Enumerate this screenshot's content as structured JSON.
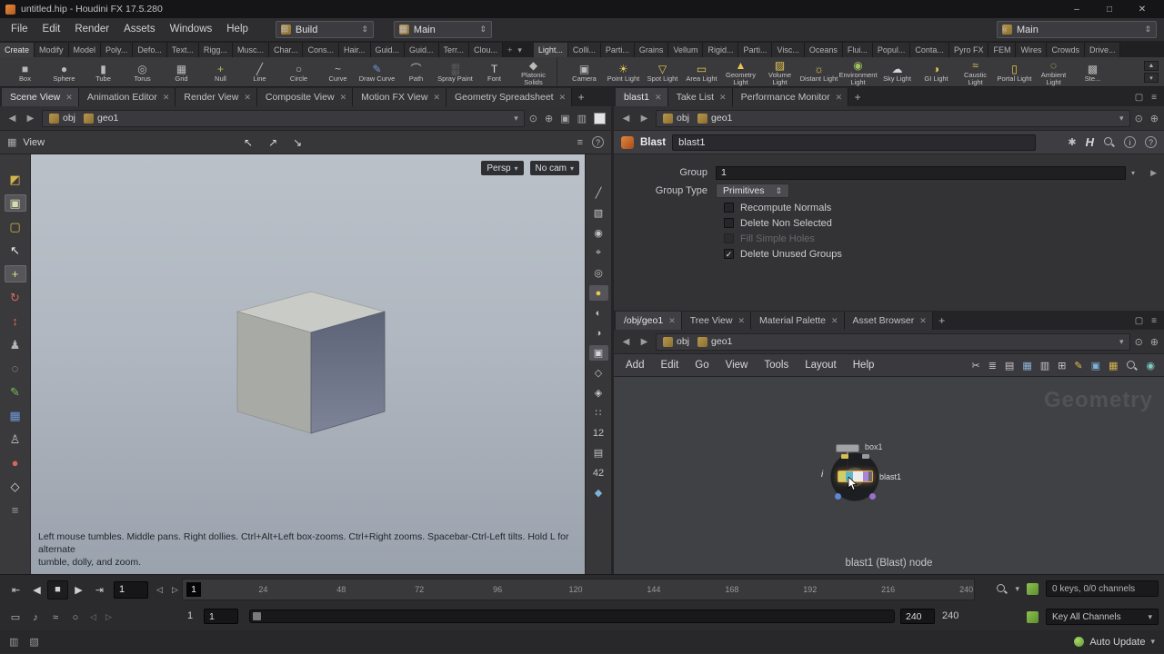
{
  "window": {
    "title": "untitled.hip - Houdini FX 17.5.280",
    "controls": {
      "minimize": "–",
      "maximize": "□",
      "close": "✕"
    }
  },
  "menubar": {
    "menus": [
      "File",
      "Edit",
      "Render",
      "Assets",
      "Windows",
      "Help"
    ],
    "desktop_combo": "Build",
    "scene_combo": "Main",
    "right_combo": "Main"
  },
  "icons": {
    "back": "◀",
    "forward": "▶",
    "down": "▾",
    "updown": "⇕",
    "add": "+",
    "close_tab": "✕",
    "pin": "⊙",
    "target": "⊕",
    "pane_max": "▢",
    "pane_menu": "≡",
    "grid": "▦",
    "presets": "✱",
    "hlogo": "H",
    "info": "i",
    "help": "?",
    "cursor1": "↖",
    "cursor2": "↗",
    "cursor3": "↘",
    "desktop_ico": "⊞",
    "scene_ico": "▦",
    "right_ico": "«",
    "cam1": "▣",
    "cam2": "▥",
    "eye": "◉",
    "tostart": "⇤",
    "prevframe": "◀",
    "stop": "■",
    "play": "▶",
    "toend": "⇥",
    "prevkey": "◁",
    "nextkey": "▷",
    "flipbook": "▭",
    "audio": "♪",
    "perf": "≈",
    "record": "○",
    "statuslog": "▥",
    "cook": "▧",
    "up": "▲"
  },
  "shelf": {
    "left_tabs": [
      {
        "label": "Create",
        "active": true
      },
      {
        "label": "Modify"
      },
      {
        "label": "Model"
      },
      {
        "label": "Poly..."
      },
      {
        "label": "Defo..."
      },
      {
        "label": "Text..."
      },
      {
        "label": "Rigg..."
      },
      {
        "label": "Musc..."
      },
      {
        "label": "Char..."
      },
      {
        "label": "Cons..."
      },
      {
        "label": "Hair..."
      },
      {
        "label": "Guid..."
      },
      {
        "label": "Guid..."
      },
      {
        "label": "Terr..."
      },
      {
        "label": "Clou..."
      }
    ],
    "right_tabs": [
      {
        "label": "Light...",
        "active": true
      },
      {
        "label": "Colli..."
      },
      {
        "label": "Parti..."
      },
      {
        "label": "Grains"
      },
      {
        "label": "Vellum"
      },
      {
        "label": "Rigid..."
      },
      {
        "label": "Parti..."
      },
      {
        "label": "Visc..."
      },
      {
        "label": "Oceans"
      },
      {
        "label": "Flui..."
      },
      {
        "label": "Popul..."
      },
      {
        "label": "Conta..."
      },
      {
        "label": "Pyro FX"
      },
      {
        "label": "FEM"
      },
      {
        "label": "Wires"
      },
      {
        "label": "Crowds"
      },
      {
        "label": "Drive..."
      }
    ],
    "left_tools": [
      {
        "label": "Box",
        "glyph": "■",
        "color": "#b9bbb6"
      },
      {
        "label": "Sphere",
        "glyph": "●",
        "color": "#b9bbb6"
      },
      {
        "label": "Tube",
        "glyph": "▮",
        "color": "#b9bbb6"
      },
      {
        "label": "Torus",
        "glyph": "◎",
        "color": "#b9bbb6"
      },
      {
        "label": "Grid",
        "glyph": "▦",
        "color": "#b9bbb6"
      },
      {
        "label": "Null",
        "glyph": "+",
        "color": "#9fc05a"
      },
      {
        "label": "Line",
        "glyph": "╱",
        "color": "#b9bbb6"
      },
      {
        "label": "Circle",
        "glyph": "○",
        "color": "#b9bbb6"
      },
      {
        "label": "Curve",
        "glyph": "~",
        "color": "#b9bbb6"
      },
      {
        "label": "Draw Curve",
        "glyph": "✎",
        "color": "#6f96d6"
      },
      {
        "label": "Path",
        "glyph": "⌒",
        "color": "#b9bbb6"
      },
      {
        "label": "Spray Paint",
        "glyph": "░",
        "color": "#b9bbb6"
      },
      {
        "label": "Font",
        "glyph": "T",
        "color": "#d8d8da"
      },
      {
        "label": "Platonic Solids",
        "glyph": "◆",
        "color": "#b9bbb6"
      }
    ],
    "right_tools": [
      {
        "label": "Camera",
        "glyph": "▣",
        "color": "#b9bbb6"
      },
      {
        "label": "Point Light",
        "glyph": "☀",
        "color": "#e6c84f"
      },
      {
        "label": "Spot Light",
        "glyph": "▽",
        "color": "#e6c84f"
      },
      {
        "label": "Area Light",
        "glyph": "▭",
        "color": "#e6c84f"
      },
      {
        "label": "Geometry Light",
        "glyph": "▲",
        "color": "#e6c84f"
      },
      {
        "label": "Volume Light",
        "glyph": "▨",
        "color": "#e6c84f"
      },
      {
        "label": "Distant Light",
        "glyph": "☼",
        "color": "#e6c84f"
      },
      {
        "label": "Environment Light",
        "glyph": "◉",
        "color": "#9fc05a"
      },
      {
        "label": "Sky Light",
        "glyph": "☁",
        "color": "#cfd6de"
      },
      {
        "label": "GI Light",
        "glyph": "◑",
        "color": "#e6c84f"
      },
      {
        "label": "Caustic Light",
        "glyph": "≈",
        "color": "#e6c84f"
      },
      {
        "label": "Portal Light",
        "glyph": "▯",
        "color": "#e6c84f"
      },
      {
        "label": "Ambient Light",
        "glyph": "◌",
        "color": "#e6c84f"
      },
      {
        "label": "Ste...",
        "glyph": "▩",
        "color": "#b9bbb6"
      }
    ]
  },
  "left_pane": {
    "tabs": [
      {
        "label": "Scene View",
        "active": true
      },
      {
        "label": "Animation Editor"
      },
      {
        "label": "Render View"
      },
      {
        "label": "Composite View"
      },
      {
        "label": "Motion FX View"
      },
      {
        "label": "Geometry Spreadsheet"
      }
    ],
    "path": [
      "obj",
      "geo1"
    ]
  },
  "right_pane": {
    "tabs": [
      {
        "label": "blast1",
        "active": true
      },
      {
        "label": "Take List"
      },
      {
        "label": "Performance Monitor"
      }
    ],
    "path": [
      "obj",
      "geo1"
    ]
  },
  "viewport": {
    "header_label": "View",
    "persp_label": "Persp",
    "cam_label": "No cam",
    "help_line1": "Left mouse tumbles. Middle pans. Right dollies. Ctrl+Alt+Left box-zooms. Ctrl+Right zooms. Spacebar-Ctrl-Left tilts. Hold L for alternate",
    "help_line2": "tumble, dolly, and zoom.",
    "left_tools": [
      {
        "name": "handles-tool-icon",
        "glyph": "◩",
        "color": "#d6b44a"
      },
      {
        "name": "select-objects-icon",
        "glyph": "▣",
        "color": "#d8dbb0",
        "active": true
      },
      {
        "name": "secure-selection-icon",
        "glyph": "▢",
        "color": "#d6b44a"
      },
      {
        "name": "select-tool-icon",
        "glyph": "↖",
        "color": "#ececee"
      },
      {
        "name": "translate-tool-icon",
        "glyph": "+",
        "color": "#e0e08a",
        "active": true
      },
      {
        "name": "rotate-tool-icon",
        "glyph": "↻",
        "color": "#d2685a"
      },
      {
        "name": "scale-tool-icon",
        "glyph": "↕",
        "color": "#d2685a"
      },
      {
        "name": "pose-tool-icon",
        "glyph": "♟",
        "color": "#b4b4b6"
      },
      {
        "name": "lasso-tool-icon",
        "glyph": "◌",
        "color": "#b4b4b6"
      },
      {
        "name": "brush-tool-icon",
        "glyph": "✎",
        "color": "#7cbf5e"
      },
      {
        "name": "edit-tool-icon",
        "glyph": "▦",
        "color": "#6f96d6"
      },
      {
        "name": "character-tool-icon",
        "glyph": "♙",
        "color": "#c4c4c6"
      },
      {
        "name": "sculpt-tool-icon",
        "glyph": "●",
        "color": "#d2685a"
      },
      {
        "name": "key-tool-icon",
        "glyph": "◇",
        "color": "#d8d8da"
      },
      {
        "name": "info-tool-icon",
        "glyph": "≡",
        "color": "#9c9c9e"
      }
    ],
    "right_tools": [
      {
        "name": "slope-display-icon",
        "glyph": "╱",
        "color": "#c2c2c4"
      },
      {
        "name": "snapshot-icon",
        "glyph": "▧",
        "color": "#c2c2c4"
      },
      {
        "name": "lock-camera-icon",
        "glyph": "◉",
        "color": "#c2c2c4"
      },
      {
        "name": "set-pivot-icon",
        "glyph": "⌖",
        "color": "#c2c2c4"
      },
      {
        "name": "view-mask-icon",
        "glyph": "◎",
        "color": "#c2c2c4"
      },
      {
        "name": "lighting-icon",
        "glyph": "●",
        "color": "#ecc94e",
        "active": true
      },
      {
        "name": "headlight-icon",
        "glyph": "◐",
        "color": "#c2c2c4"
      },
      {
        "name": "shadows-icon",
        "glyph": "◑",
        "color": "#c2c2c4"
      },
      {
        "name": "shading-mode-icon",
        "glyph": "▣",
        "color": "#d2d6da",
        "active": true
      },
      {
        "name": "wireframe-icon",
        "glyph": "◇",
        "color": "#c2c2c4"
      },
      {
        "name": "xray-icon",
        "glyph": "◈",
        "color": "#c2c2c4"
      },
      {
        "name": "points-icon",
        "glyph": "∷",
        "color": "#c2c2c4"
      },
      {
        "name": "lod-badge",
        "glyph": "12",
        "color": "#c2c2c4",
        "text": true
      },
      {
        "name": "groups-icon",
        "glyph": "▤",
        "color": "#c2c2c4"
      },
      {
        "name": "lod2-badge",
        "glyph": "42",
        "color": "#c2c2c4",
        "text": true
      },
      {
        "name": "visualizer-icon",
        "glyph": "◆",
        "color": "#80b2d8"
      }
    ]
  },
  "params": {
    "node_type": "Blast",
    "node_name": "blast1",
    "group_label": "Group",
    "group_value": "1",
    "group_type_label": "Group Type",
    "group_type_value": "Primitives",
    "toggles": [
      {
        "label": "Recompute Normals",
        "mark": "",
        "disabled": false
      },
      {
        "label": "Delete Non Selected",
        "mark": "",
        "disabled": false
      },
      {
        "label": "Fill Simple Holes",
        "mark": "",
        "disabled": true
      },
      {
        "label": "Delete Unused Groups",
        "mark": "✓",
        "disabled": false
      }
    ]
  },
  "network": {
    "tabs": [
      {
        "label": "/obj/geo1",
        "active": true
      },
      {
        "label": "Tree View"
      },
      {
        "label": "Material Palette"
      },
      {
        "label": "Asset Browser"
      }
    ],
    "path": [
      "obj",
      "geo1"
    ],
    "menus": [
      "Add",
      "Edit",
      "Go",
      "View",
      "Tools",
      "Layout",
      "Help"
    ],
    "menu_icons": [
      {
        "name": "network-tools-icon",
        "glyph": "✂",
        "color": "#c8c8ca"
      },
      {
        "name": "tree-list-icon",
        "glyph": "≣",
        "color": "#c8c8ca"
      },
      {
        "name": "list-view-icon",
        "glyph": "▤",
        "color": "#c8c8ca"
      },
      {
        "name": "grid-view-icon",
        "glyph": "▦",
        "color": "#8fb4d8"
      },
      {
        "name": "detail-view-icon",
        "glyph": "▥",
        "color": "#c8c8ca"
      },
      {
        "name": "data-view-icon",
        "glyph": "⊞",
        "color": "#c8c8ca"
      },
      {
        "name": "notes-icon",
        "glyph": "✎",
        "color": "#e0c050"
      },
      {
        "name": "image-icon",
        "glyph": "▣",
        "color": "#7fb2d9"
      },
      {
        "name": "asset-icon",
        "glyph": "▦",
        "color": "#d8b44a"
      }
    ],
    "watermark": "Geometry",
    "nodes": [
      {
        "name": "box1"
      },
      {
        "name": "blast1",
        "selected": true
      }
    ],
    "info_badge": "i",
    "status": "blast1 (Blast) node"
  },
  "playbar": {
    "frame": "1",
    "current_frame": "1",
    "ticks": [
      24,
      48,
      72,
      96,
      120,
      144,
      168,
      192,
      216,
      240
    ],
    "range_start_label": "1",
    "range_start": "1",
    "range_end": "240",
    "range_end_label": "240",
    "keys_info": "0 keys, 0/0 channels",
    "key_all": "Key All Channels",
    "auto_update": "Auto Update"
  }
}
